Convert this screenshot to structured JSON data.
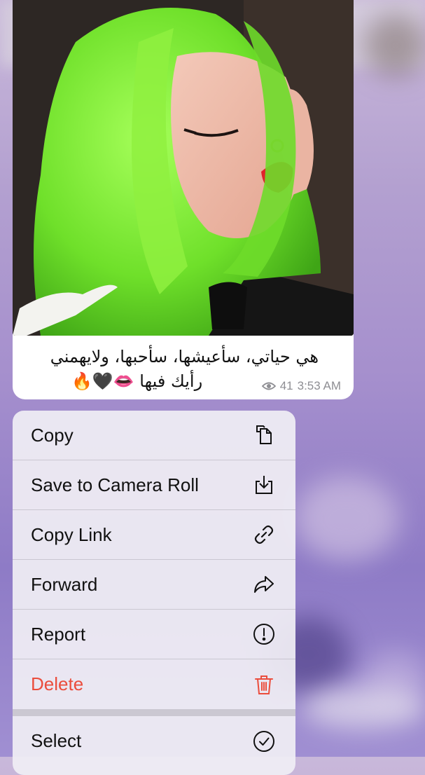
{
  "message": {
    "caption_line1": "هي حياتي، سأعيشها، سأحبها، ولايهمني",
    "caption_line2": "رأيك فيها 👄🖤🔥",
    "views": "41",
    "time": "3:53 AM"
  },
  "menu": {
    "items": [
      {
        "label": "Copy",
        "icon": "copy-icon"
      },
      {
        "label": "Save to Camera Roll",
        "icon": "save-download-icon"
      },
      {
        "label": "Copy Link",
        "icon": "link-icon"
      },
      {
        "label": "Forward",
        "icon": "forward-arrow-icon"
      },
      {
        "label": "Report",
        "icon": "exclamation-circle-icon"
      },
      {
        "label": "Delete",
        "icon": "trash-icon"
      },
      {
        "label": "Select",
        "icon": "checkmark-circle-icon"
      }
    ]
  },
  "colors": {
    "destructive": "#eb4d3d",
    "hair": "#7ee832",
    "background": "#a58fcd"
  }
}
